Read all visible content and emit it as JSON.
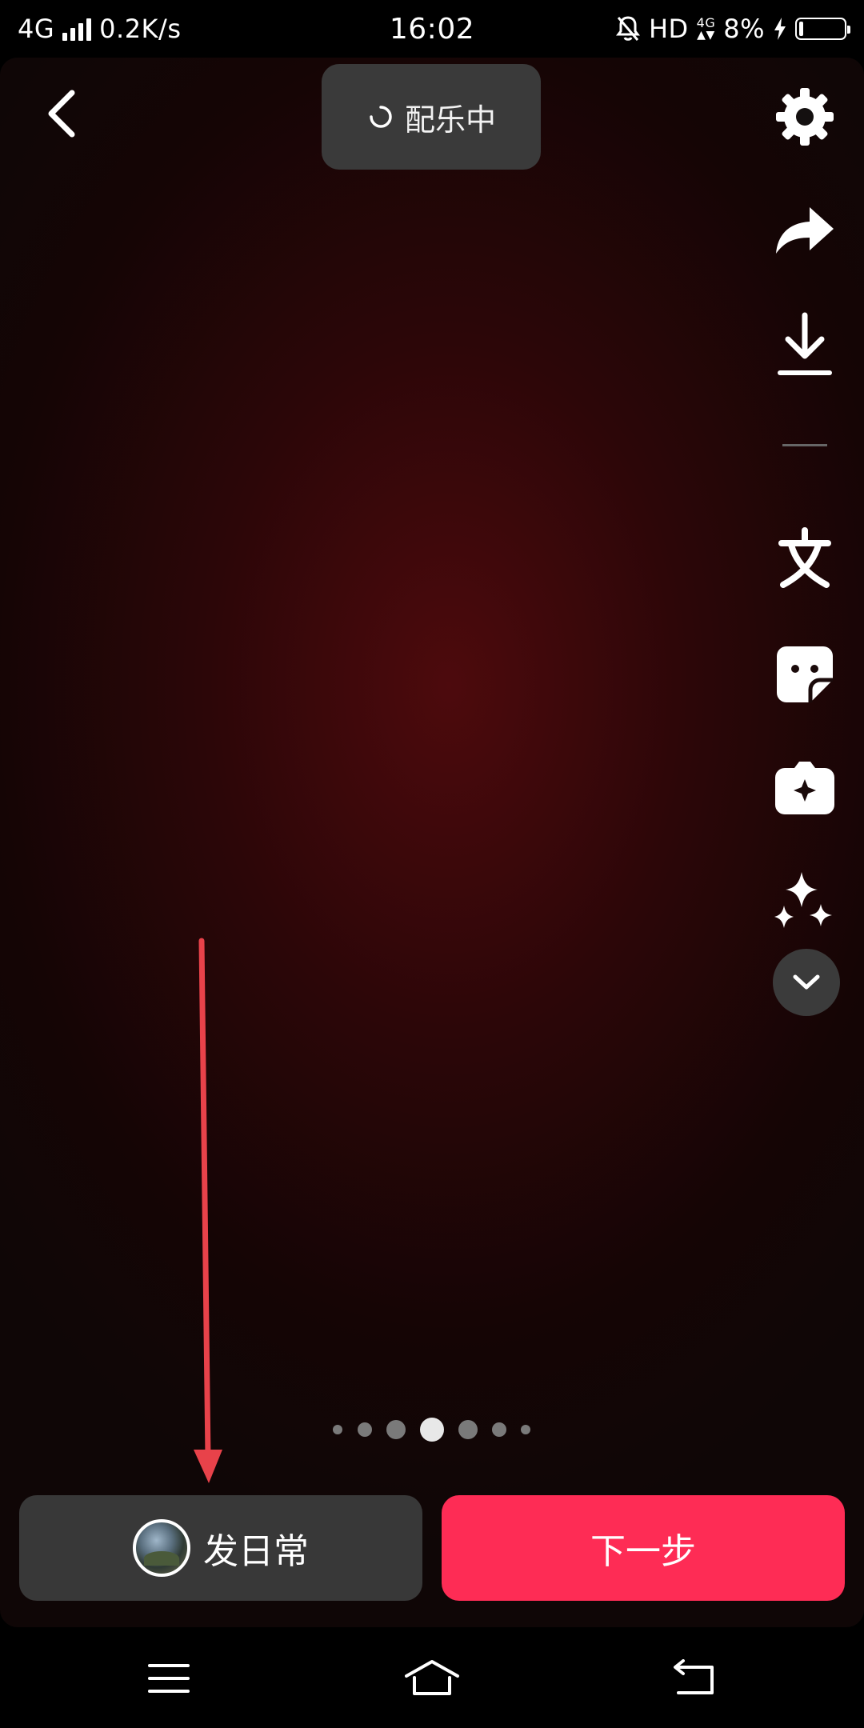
{
  "status_bar": {
    "network": "4G",
    "speed": "0.2K/s",
    "time": "16:02",
    "hd": "HD",
    "net_type_small": "4G",
    "battery": "8%",
    "icons": [
      "signal-icon",
      "mute-bell-icon",
      "data-arrows-icon",
      "charging-icon",
      "battery-icon"
    ]
  },
  "editor": {
    "music_status": "配乐中",
    "tools": [
      "settings-icon",
      "share-icon",
      "download-icon",
      "text-icon",
      "sticker-icon",
      "effects-icon",
      "sparkle-icon",
      "expand-more-icon"
    ],
    "page_indicator": {
      "count": 7,
      "active_index": 3
    }
  },
  "bottom": {
    "daily_label": "发日常",
    "next_label": "下一步"
  },
  "nav": {
    "icons": [
      "menu-icon",
      "home-icon",
      "back-nav-icon"
    ]
  },
  "colors": {
    "accent": "#fe2c55",
    "annotation": "#e8424a",
    "button_dark": "#383838"
  }
}
